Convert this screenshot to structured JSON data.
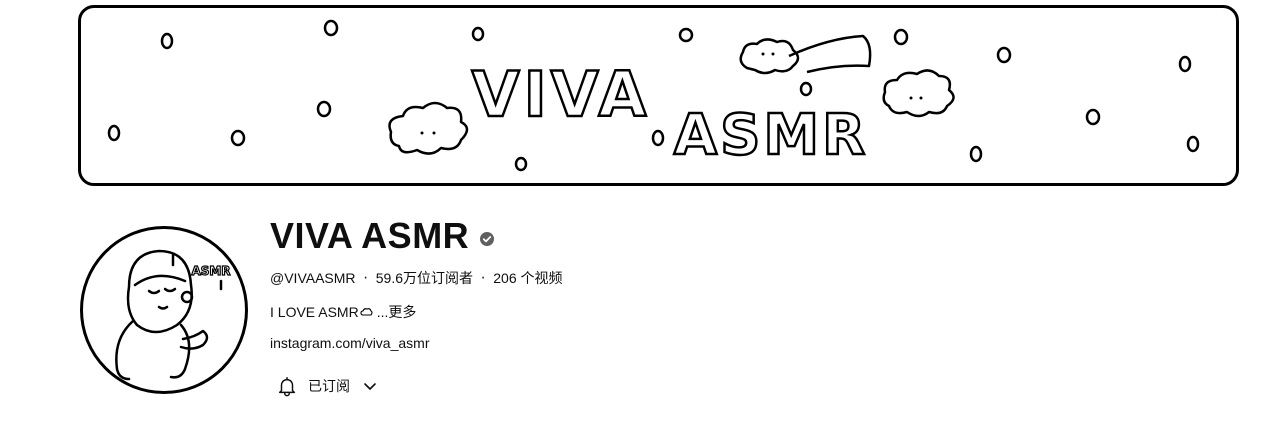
{
  "channel": {
    "name": "VIVA ASMR",
    "handle": "@VIVAASMR",
    "subscribers": "59.6万位订阅者",
    "videos": "206 个视频",
    "separator": "‧",
    "description": "I LOVE ASMR",
    "more_label": "...更多",
    "link": "instagram.com/viva_asmr"
  },
  "banner": {
    "title_line1": "VIVA",
    "title_line2": "ASMR"
  },
  "avatar": {
    "badge_text": "ASMR"
  },
  "subscribe_button": {
    "label": "已订阅",
    "icon": "bell-icon",
    "dropdown_icon": "chevron-down-icon"
  },
  "icons": {
    "verified": "check-circle-icon"
  },
  "colors": {
    "text": "#0f0f0f",
    "border": "#000000",
    "background": "#ffffff"
  }
}
